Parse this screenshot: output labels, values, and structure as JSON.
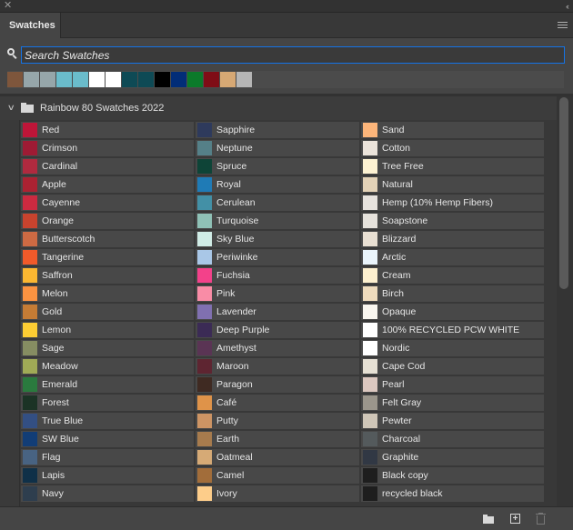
{
  "window": {
    "close_glyph": "✕",
    "collapse_glyph": "‹‹"
  },
  "tabs": [
    {
      "label": "Swatches",
      "active": true
    }
  ],
  "search": {
    "placeholder": "Search Swatches",
    "value": ""
  },
  "recent_swatches": [
    "#7e563c",
    "#96a6aa",
    "#96a6aa",
    "#6abccb",
    "#6abccb",
    "#ffffff",
    "#ffffff",
    "#0e4a55",
    "#0e4a55",
    "#000000",
    "#022d78",
    "#0b7a2a",
    "#7f0d16",
    "#d6a874",
    "#b6b6b6"
  ],
  "group": {
    "name": "Rainbow 80 Swatches 2022",
    "expanded": true
  },
  "columns": [
    [
      {
        "name": "Red",
        "color": "#be1538"
      },
      {
        "name": "Crimson",
        "color": "#9e1b34"
      },
      {
        "name": "Cardinal",
        "color": "#b02a3f"
      },
      {
        "name": "Apple",
        "color": "#ab2232"
      },
      {
        "name": "Cayenne",
        "color": "#cc2a40"
      },
      {
        "name": "Orange",
        "color": "#c9432e"
      },
      {
        "name": "Butterscotch",
        "color": "#cd6a43"
      },
      {
        "name": "Tangerine",
        "color": "#f15a2a"
      },
      {
        "name": "Saffron",
        "color": "#fbb731"
      },
      {
        "name": "Melon",
        "color": "#fb9341"
      },
      {
        "name": "Gold",
        "color": "#c57c35"
      },
      {
        "name": "Lemon",
        "color": "#fdcd33"
      },
      {
        "name": "Sage",
        "color": "#868d62"
      },
      {
        "name": "Meadow",
        "color": "#a0aa56"
      },
      {
        "name": "Emerald",
        "color": "#2a7a3e"
      },
      {
        "name": "Forest",
        "color": "#1b3325"
      },
      {
        "name": "True Blue",
        "color": "#334f83"
      },
      {
        "name": "SW Blue",
        "color": "#123d76"
      },
      {
        "name": "Flag",
        "color": "#486382"
      },
      {
        "name": "Lapis",
        "color": "#0f3048"
      },
      {
        "name": "Navy",
        "color": "#2e3e4e"
      }
    ],
    [
      {
        "name": "Sapphire",
        "color": "#2e3a5c"
      },
      {
        "name": "Neptune",
        "color": "#558088"
      },
      {
        "name": "Spruce",
        "color": "#0e4437"
      },
      {
        "name": "Royal",
        "color": "#1f7bb6"
      },
      {
        "name": "Cerulean",
        "color": "#4390a6"
      },
      {
        "name": "Turquoise",
        "color": "#8fc1b6"
      },
      {
        "name": "Sky Blue",
        "color": "#d0ece6"
      },
      {
        "name": "Periwinke",
        "color": "#a9c7e7"
      },
      {
        "name": "Fuchsia",
        "color": "#f3418a"
      },
      {
        "name": "Pink",
        "color": "#f98ca6"
      },
      {
        "name": "Lavender",
        "color": "#8070b0"
      },
      {
        "name": "Deep Purple",
        "color": "#3b2b55"
      },
      {
        "name": "Amethyst",
        "color": "#5a3454"
      },
      {
        "name": "Maroon",
        "color": "#5e2531"
      },
      {
        "name": "Paragon",
        "color": "#3f2a22"
      },
      {
        "name": "Café",
        "color": "#df9349"
      },
      {
        "name": "Putty",
        "color": "#cd9464"
      },
      {
        "name": "Earth",
        "color": "#a77b4d"
      },
      {
        "name": "Oatmeal",
        "color": "#d6aa76"
      },
      {
        "name": "Camel",
        "color": "#a26d3a"
      },
      {
        "name": "Ivory",
        "color": "#fdcd8a"
      }
    ],
    [
      {
        "name": "Sand",
        "color": "#fcb57a"
      },
      {
        "name": "Cotton",
        "color": "#ebe3da"
      },
      {
        "name": "Tree Free",
        "color": "#fdf2d2"
      },
      {
        "name": "Natural",
        "color": "#e3d2b7"
      },
      {
        "name": "Hemp (10% Hemp Fibers)",
        "color": "#e6e2dd"
      },
      {
        "name": "Soapstone",
        "color": "#e6e2dc"
      },
      {
        "name": "Blizzard",
        "color": "#e8dfd2"
      },
      {
        "name": "Arctic",
        "color": "#eaf4fb"
      },
      {
        "name": "Cream",
        "color": "#fdf0cf"
      },
      {
        "name": "Birch",
        "color": "#eedbbd"
      },
      {
        "name": "Opaque",
        "color": "#f9f6ef"
      },
      {
        "name": "100% RECYCLED PCW WHITE",
        "color": "#ffffff"
      },
      {
        "name": "Nordic",
        "color": "#ffffff"
      },
      {
        "name": "Cape Cod",
        "color": "#e6e0d4"
      },
      {
        "name": "Pearl",
        "color": "#dcc8c0"
      },
      {
        "name": "Felt Gray",
        "color": "#9b968c"
      },
      {
        "name": "Pewter",
        "color": "#cfc6b8"
      },
      {
        "name": "Charcoal",
        "color": "#545a5c"
      },
      {
        "name": "Graphite",
        "color": "#313844"
      },
      {
        "name": "Black copy",
        "color": "#1e1e1e"
      },
      {
        "name": "recycled black",
        "color": "#1e1e1e"
      }
    ]
  ],
  "scrollbar": {
    "position": 0,
    "visible_fraction": 0.47
  },
  "footer": {
    "buttons": [
      "new-group",
      "new-swatch",
      "delete-swatch"
    ]
  }
}
